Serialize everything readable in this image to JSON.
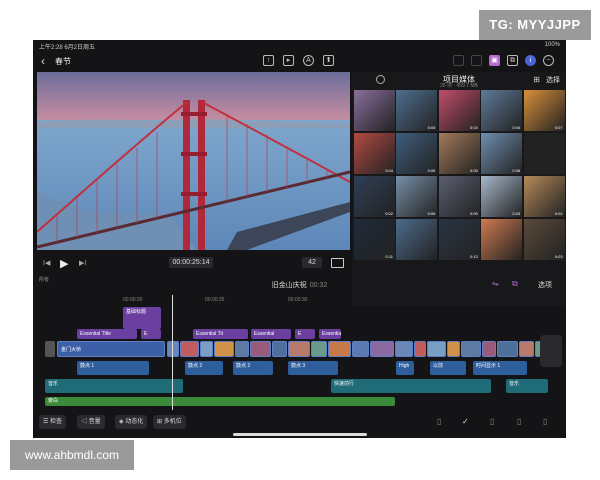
{
  "watermarks": {
    "top": "TG: MYYJJPP",
    "bottom": "www.ahbmdl.com"
  },
  "status_bar": {
    "left": "上午2:28  6月2日周五",
    "right": "100%"
  },
  "top_bar": {
    "back_icon": "chevron-left-icon",
    "project_name": "春节"
  },
  "player": {
    "timecode": "00:00:25:14",
    "zoom": "42"
  },
  "browser": {
    "title": "项目媒体",
    "subtitle": "26 项 · 459.7 MB",
    "select_label": "选择",
    "durations": [
      "",
      "0:05",
      "0:04",
      "0:04",
      "0:07",
      "0:04",
      "0:06",
      "0:05",
      "0:08",
      "",
      "0:02",
      "0:06",
      "0:05",
      "0:03",
      "0:02",
      "0:11",
      "",
      "0:13",
      "",
      "0:03"
    ]
  },
  "timeline": {
    "title": "旧金山庆祝",
    "duration": "00:32",
    "options_label": "选项",
    "header_label": "所有",
    "ruler": [
      "00:00:20",
      "00:00:25",
      "00:00:30"
    ],
    "title_clips": [
      "Essential Title",
      "E",
      "Essential Tit",
      "Essential",
      "E",
      "Essential"
    ],
    "lower_clip": "基础标题",
    "primary_label": "金门大桥",
    "audio_clips": [
      "鼓点 1",
      "鼓点 2",
      "鼓点 2",
      "鼓点 3",
      "High",
      "以前",
      "时间显示 1"
    ],
    "music_clips": [
      "音乐",
      "快速前行",
      "音乐"
    ],
    "green_clip": "旁白"
  },
  "bottom_bar": {
    "inspect": "检查",
    "volume": "音量",
    "animate": "动态化",
    "multicam": "多机位"
  }
}
